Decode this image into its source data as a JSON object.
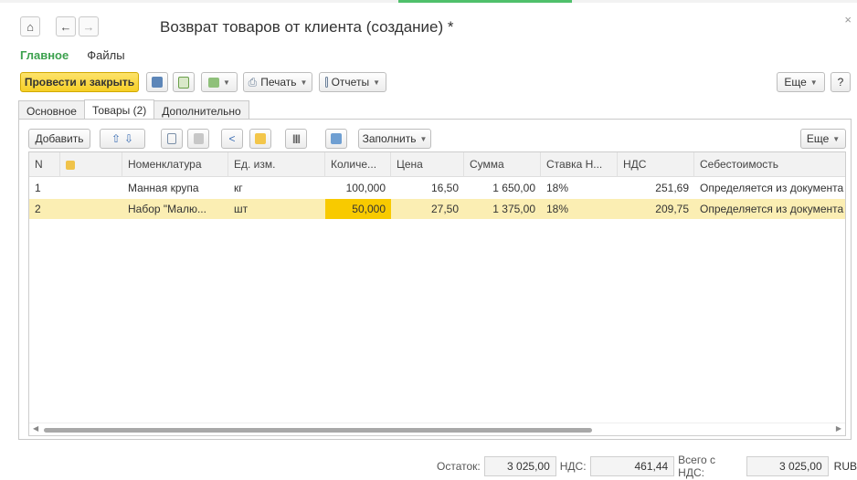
{
  "window": {
    "title": "Возврат товаров от клиента (создание) *",
    "close_glyph": "×"
  },
  "nav": {
    "home_icon": "home-icon",
    "back_icon": "arrow-left-icon",
    "forward_icon": "arrow-right-icon"
  },
  "sections": {
    "main": "Главное",
    "files": "Файлы"
  },
  "toolbar": {
    "post_close": "Провести и закрыть",
    "print": "Печать",
    "reports": "Отчеты",
    "more": "Еще",
    "help": "?"
  },
  "tabs": [
    "Основное",
    "Товары (2)",
    "Дополнительно"
  ],
  "goods_toolbar": {
    "add": "Добавить",
    "fill": "Заполнить",
    "more": "Еще"
  },
  "table": {
    "columns": [
      "N",
      "",
      "Номенклатура",
      "Ед. изм.",
      "Количе...",
      "Цена",
      "Сумма",
      "Ставка Н...",
      "НДС",
      "Себестоимость"
    ],
    "rows": [
      {
        "n": "1",
        "name": "Манная крупа",
        "unit": "кг",
        "qty": "100,000",
        "price": "16,50",
        "sum": "1 650,00",
        "vat_rate": "18%",
        "vat": "251,69",
        "cost": "Определяется из документа Ре"
      },
      {
        "n": "2",
        "name": "Набор \"Малю...",
        "unit": "шт",
        "qty": "50,000",
        "price": "27,50",
        "sum": "1 375,00",
        "vat_rate": "18%",
        "vat": "209,75",
        "cost": "Определяется из документа Ре"
      }
    ]
  },
  "totals": {
    "rest_label": "Остаток:",
    "rest_value": "3 025,00",
    "vat_label": "НДС:",
    "vat_value": "461,44",
    "total_label": "Всего с НДС:",
    "total_value": "3 025,00",
    "currency": "RUB"
  },
  "colors": {
    "accent_green": "#3ca14e",
    "primary_yellow": "#f6cf26",
    "selected_row": "#fbeeb3"
  }
}
